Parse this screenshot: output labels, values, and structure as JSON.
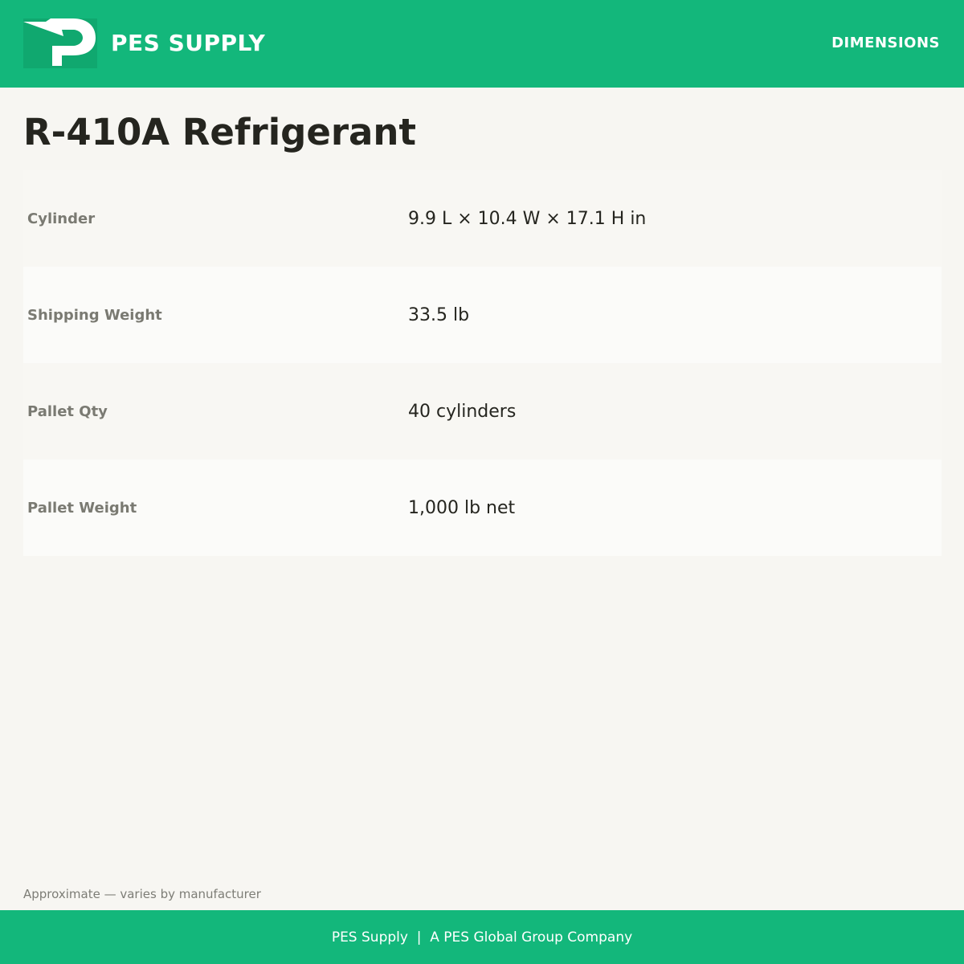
{
  "header": {
    "logo_icon": "pes-logo-icon",
    "brand": "PES SUPPLY",
    "nav_label": "DIMENSIONS"
  },
  "page": {
    "title": "R-410A Refrigerant"
  },
  "specs": [
    {
      "label": "Cylinder",
      "value": "9.9 L × 10.4 W × 17.1 H in"
    },
    {
      "label": "Shipping Weight",
      "value": "33.5 lb"
    },
    {
      "label": "Pallet Qty",
      "value": "40 cylinders"
    },
    {
      "label": "Pallet Weight",
      "value": "1,000 lb net"
    }
  ],
  "note": "Approximate — varies by manufacturer",
  "footer": {
    "text": "PES Supply  |  A PES Global Group Company"
  },
  "colors": {
    "brand_green": "#13b77b",
    "background": "#f7f6f2",
    "text_dark": "#25251f",
    "text_muted": "#7a7a72"
  }
}
